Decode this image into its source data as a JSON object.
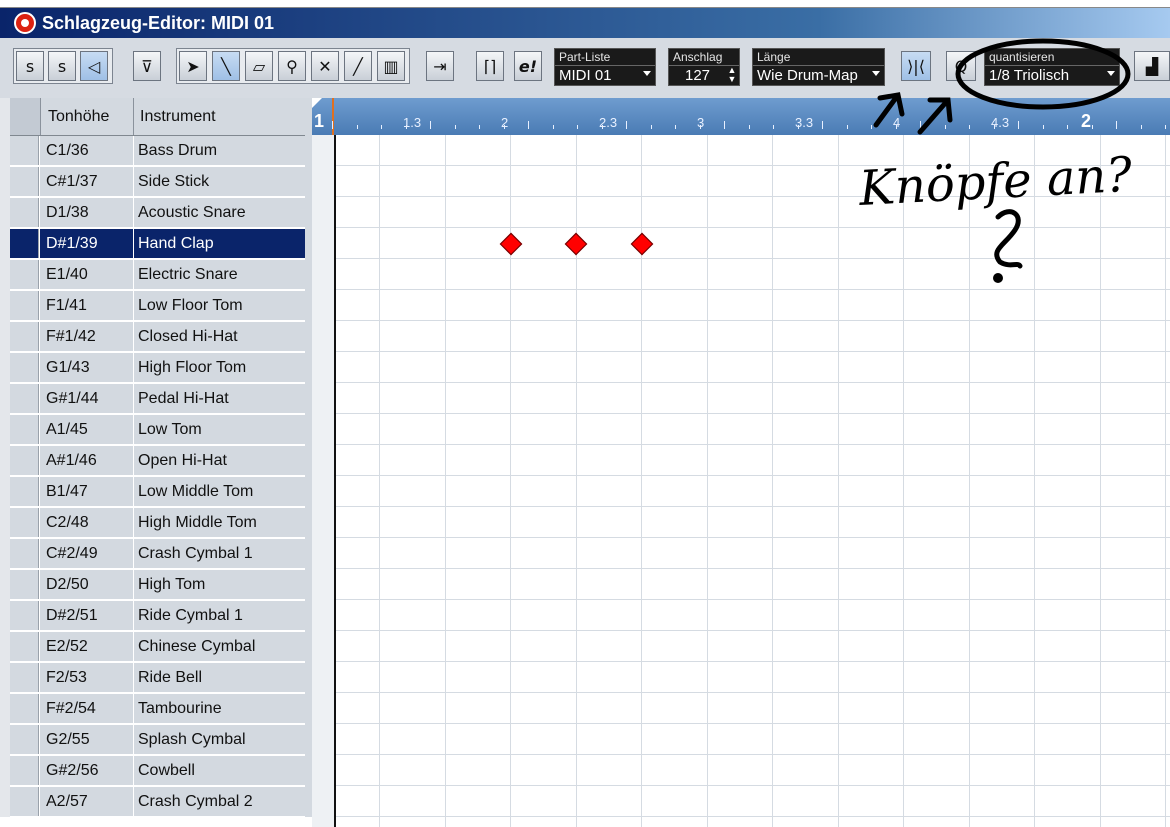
{
  "window": {
    "title": "Schlagzeug-Editor: MIDI 01"
  },
  "toolbar": {
    "part_list": {
      "label": "Part-Liste",
      "value": "MIDI 01"
    },
    "velocity": {
      "label": "Anschlag",
      "value": "127"
    },
    "length": {
      "label": "Länge",
      "value": "Wie Drum-Map"
    },
    "quantize": {
      "label": "quantisieren",
      "value": "1/8 Triolisch"
    },
    "e_button": "e!"
  },
  "list": {
    "header_pitch": "Tonhöhe",
    "header_instrument": "Instrument",
    "rows": [
      {
        "pitch": "C1/36",
        "instrument": "Bass Drum"
      },
      {
        "pitch": "C#1/37",
        "instrument": "Side Stick"
      },
      {
        "pitch": "D1/38",
        "instrument": "Acoustic Snare"
      },
      {
        "pitch": "D#1/39",
        "instrument": "Hand Clap"
      },
      {
        "pitch": "E1/40",
        "instrument": "Electric Snare"
      },
      {
        "pitch": "F1/41",
        "instrument": "Low Floor Tom"
      },
      {
        "pitch": "F#1/42",
        "instrument": "Closed Hi-Hat"
      },
      {
        "pitch": "G1/43",
        "instrument": "High Floor Tom"
      },
      {
        "pitch": "G#1/44",
        "instrument": "Pedal Hi-Hat"
      },
      {
        "pitch": "A1/45",
        "instrument": "Low Tom"
      },
      {
        "pitch": "A#1/46",
        "instrument": "Open Hi-Hat"
      },
      {
        "pitch": "B1/47",
        "instrument": "Low Middle Tom"
      },
      {
        "pitch": "C2/48",
        "instrument": "High Middle Tom"
      },
      {
        "pitch": "C#2/49",
        "instrument": "Crash Cymbal 1"
      },
      {
        "pitch": "D2/50",
        "instrument": "High Tom"
      },
      {
        "pitch": "D#2/51",
        "instrument": "Ride Cymbal 1"
      },
      {
        "pitch": "E2/52",
        "instrument": "Chinese Cymbal"
      },
      {
        "pitch": "F2/53",
        "instrument": "Ride Bell"
      },
      {
        "pitch": "F#2/54",
        "instrument": "Tambourine"
      },
      {
        "pitch": "G2/55",
        "instrument": "Splash Cymbal"
      },
      {
        "pitch": "G#2/56",
        "instrument": "Cowbell"
      },
      {
        "pitch": "A2/57",
        "instrument": "Crash Cymbal 2"
      }
    ],
    "selected_index": 3
  },
  "ruler": {
    "labels": [
      "1",
      "1.3",
      "2",
      "2.3",
      "3",
      "3.3",
      "4",
      "4.3",
      "2"
    ]
  },
  "notes": {
    "instrument": "Hand Clap",
    "positions": [
      "2",
      "2.2",
      "2.3"
    ]
  },
  "annotation": {
    "handwritten_text": "Knöpfe an?"
  },
  "colors": {
    "selection": "#0a246a",
    "note": "#ff0000",
    "ruler": "#5a89c2"
  }
}
